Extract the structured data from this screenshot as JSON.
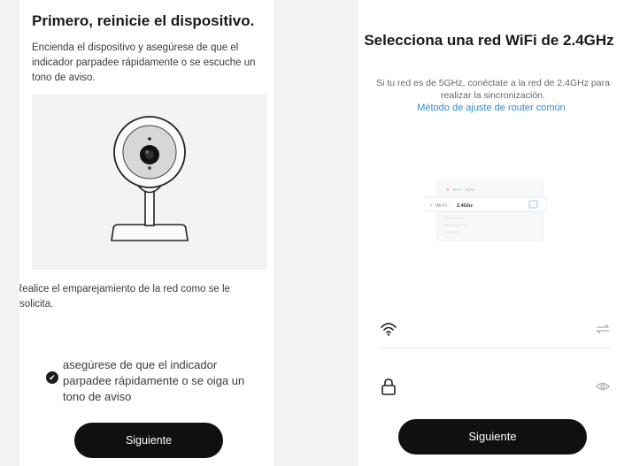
{
  "left": {
    "title": "Primero, reinicie el dispositivo.",
    "description": "Encienda el dispositivo y asegúrese de que el indicador parpadee rápidamente o se escuche un tono de aviso.",
    "note": "Realice el emparejamiento de la red como se le solicita.",
    "confirm_checkbox": {
      "checked": true,
      "label": "asegúrese de que el indicador parpadee rápidamente o se oiga un tono de aviso"
    },
    "next_button": "Siguiente"
  },
  "right": {
    "title": "Selecciona una red WiFi de 2.4GHz",
    "description": "Si tu red es de 5GHz, conéctate a la red de 2.4GHz para realizar la sincronización.",
    "router_link": "Método de ajuste de router común",
    "illustration": {
      "row_5g": "Wi-Fi · 5Ghz",
      "row_24g_prefix": "Wi-Fi ·",
      "row_24g_band": "2.4Ghz"
    },
    "wifi_field": {
      "value": "",
      "placeholder": ""
    },
    "password_field": {
      "value": "",
      "placeholder": ""
    },
    "next_button": "Siguiente"
  },
  "colors": {
    "button_bg": "#101010",
    "link": "#2a8bd6",
    "check_ok": "#2dbd6e",
    "check_bad": "#e65a5a"
  },
  "icons": [
    "check-circle-icon",
    "wifi-icon",
    "swap-icon",
    "lock-icon",
    "eye-icon"
  ]
}
